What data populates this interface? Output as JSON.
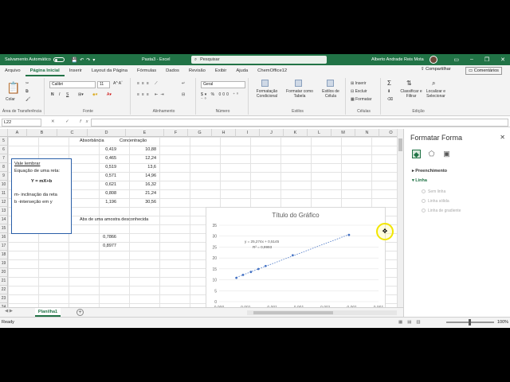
{
  "titlebar": {
    "autosave_label": "Salvamento Automático",
    "doc_title": "Pasta3 - Excel",
    "search_placeholder": "Pesquisar",
    "user_name": "Alberto Andrade Reis Mota"
  },
  "tabs": [
    "Arquivo",
    "Página Inicial",
    "Inserir",
    "Layout da Página",
    "Fórmulas",
    "Dados",
    "Revisão",
    "Exibir",
    "Ajuda",
    "ChemOffice12"
  ],
  "active_tab": "Página Inicial",
  "share_label": "Compartilhar",
  "comments_label": "Comentários",
  "ribbon": {
    "paste_label": "Colar",
    "clipboard_label": "Área de Transferência",
    "font_name": "Calibri",
    "font_size": "11",
    "bold": "N",
    "italic": "I",
    "underline": "S",
    "font_label": "Fonte",
    "alignment_label": "Alinhamento",
    "number_format": "Geral",
    "number_label": "Número",
    "cond_format_label": "Formatação Condicional",
    "format_table_label": "Formatar como Tabela",
    "cell_styles_label": "Estilos de Célula",
    "styles_label": "Estilos",
    "insert_label": "Inserir",
    "delete_label": "Excluir",
    "format_label": "Formatar",
    "cells_label": "Células",
    "sort_filter_label": "Classificar e Filtrar",
    "find_select_label": "Localizar e Selecionar",
    "editing_label": "Edição"
  },
  "formula_bar": {
    "name_box": "L22",
    "fx": "fx",
    "value": ""
  },
  "columns": [
    "A",
    "B",
    "C",
    "D",
    "E",
    "F",
    "G",
    "H",
    "I",
    "J",
    "K",
    "L",
    "M",
    "N",
    "O"
  ],
  "rows": [
    "5",
    "6",
    "7",
    "8",
    "9",
    "10",
    "11",
    "12",
    "13",
    "14",
    "15",
    "16",
    "17",
    "18",
    "19",
    "20",
    "21",
    "22",
    "23",
    "24"
  ],
  "table": {
    "header_abs": "Absorbância",
    "header_conc": "Concentração",
    "absorbance": [
      "0,419",
      "0,465",
      "0,519",
      "0,571",
      "0,621",
      "0,808",
      "1,196"
    ],
    "concentration": [
      "10,88",
      "12,24",
      "13,6",
      "14,96",
      "16,32",
      "21,24",
      "30,56"
    ],
    "unknown_label": "Abs de uma amostra desconhecida",
    "unknown_values": [
      "0,7866",
      "0,8977"
    ]
  },
  "note": {
    "title": "Vale lembrar",
    "line1": "Equação de uma reta:",
    "formula": "Y = mX+b",
    "line3": "m- inclinação da reta",
    "line4": "b -interseção em y"
  },
  "chart_data": {
    "type": "scatter",
    "title": "Título do Gráfico",
    "equation": "y = 25,274x + 0,5145",
    "r_squared": "R² = 0,9993",
    "x": [
      0.419,
      0.465,
      0.519,
      0.571,
      0.621,
      0.808,
      1.196
    ],
    "y": [
      10.88,
      12.24,
      13.6,
      14.96,
      16.32,
      21.24,
      30.56
    ],
    "yticks": [
      "0",
      "5",
      "10",
      "15",
      "20",
      "25",
      "30",
      "35"
    ],
    "xticks": [
      "0.000",
      "0.001",
      "0.001",
      "0.001",
      "0.001",
      "0.001",
      "0.001"
    ],
    "ylim": [
      0,
      35
    ],
    "trendline": true,
    "series_color": "#4472c4"
  },
  "sheet_tab": "Planilha1",
  "status": "Ready",
  "zoom": "100%",
  "pane": {
    "title": "Formatar Forma",
    "section_fill": "Preenchimento",
    "section_line": "Linha",
    "opt_none": "Sem linha",
    "opt_solid": "Linha sólida",
    "opt_gradient": "Linha de gradiente"
  }
}
